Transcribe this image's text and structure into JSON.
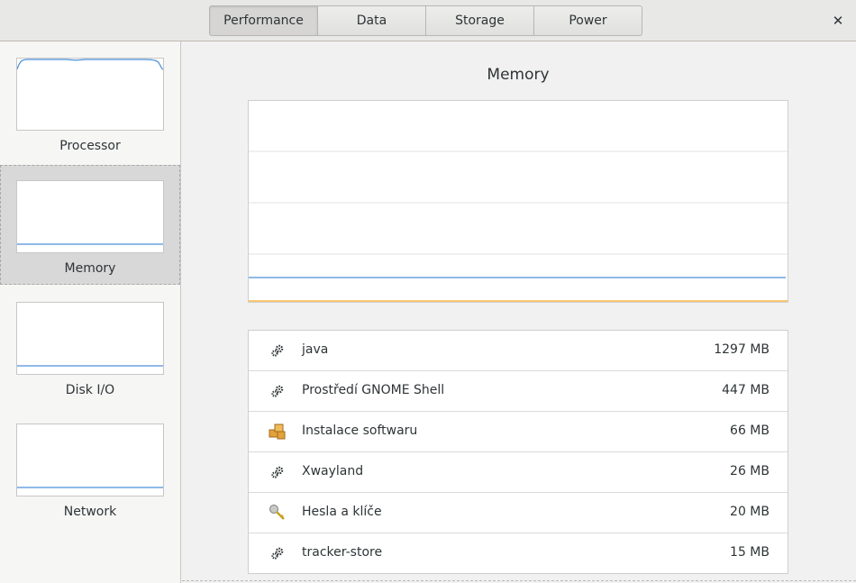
{
  "tabs": [
    {
      "label": "Performance",
      "active": true
    },
    {
      "label": "Data",
      "active": false
    },
    {
      "label": "Storage",
      "active": false
    },
    {
      "label": "Power",
      "active": false
    }
  ],
  "close_icon": "close-icon",
  "sidebar": {
    "items": [
      {
        "label": "Processor",
        "selected": false
      },
      {
        "label": "Memory",
        "selected": true
      },
      {
        "label": "Disk I/O",
        "selected": false
      },
      {
        "label": "Network",
        "selected": false
      }
    ]
  },
  "main": {
    "title": "Memory",
    "graph_colors": {
      "used": "#4a90d9",
      "swap": "#f5a623"
    },
    "processes": [
      {
        "name": "java",
        "size": "1297 MB",
        "icon": "gears-icon"
      },
      {
        "name": "Prostředí GNOME Shell",
        "size": "447 MB",
        "icon": "gears-icon"
      },
      {
        "name": "Instalace softwaru",
        "size": "66 MB",
        "icon": "package-icon"
      },
      {
        "name": "Xwayland",
        "size": "26 MB",
        "icon": "gears-icon"
      },
      {
        "name": "Hesla a klíče",
        "size": "20 MB",
        "icon": "key-icon"
      },
      {
        "name": "tracker-store",
        "size": "15 MB",
        "icon": "gears-icon"
      }
    ]
  }
}
